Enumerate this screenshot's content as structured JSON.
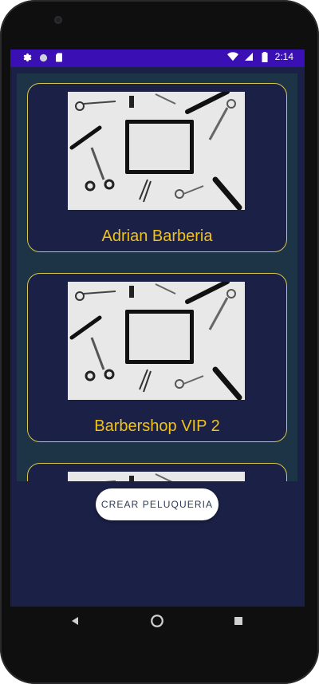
{
  "statusbar": {
    "time": "2:14",
    "left_icons": [
      "settings-icon",
      "circle-icon",
      "sim-card-icon"
    ],
    "right_icons": [
      "wifi-icon",
      "signal-icon",
      "battery-icon"
    ]
  },
  "list": {
    "cards": [
      {
        "title": "Adrian Barberia"
      },
      {
        "title": "Barbershop VIP 2"
      },
      {
        "title": ""
      }
    ]
  },
  "actions": {
    "create_label": "CREAR PELUQUERIA"
  },
  "navbar": {
    "icons": [
      "back-icon",
      "home-icon",
      "recents-icon"
    ]
  },
  "colors": {
    "statusbar": "#3a0fb4",
    "background": "#1b2146",
    "list_background": "#1d3447",
    "card_border": "#d6c64a",
    "title": "#f1c21a",
    "button": "#ffffff"
  }
}
